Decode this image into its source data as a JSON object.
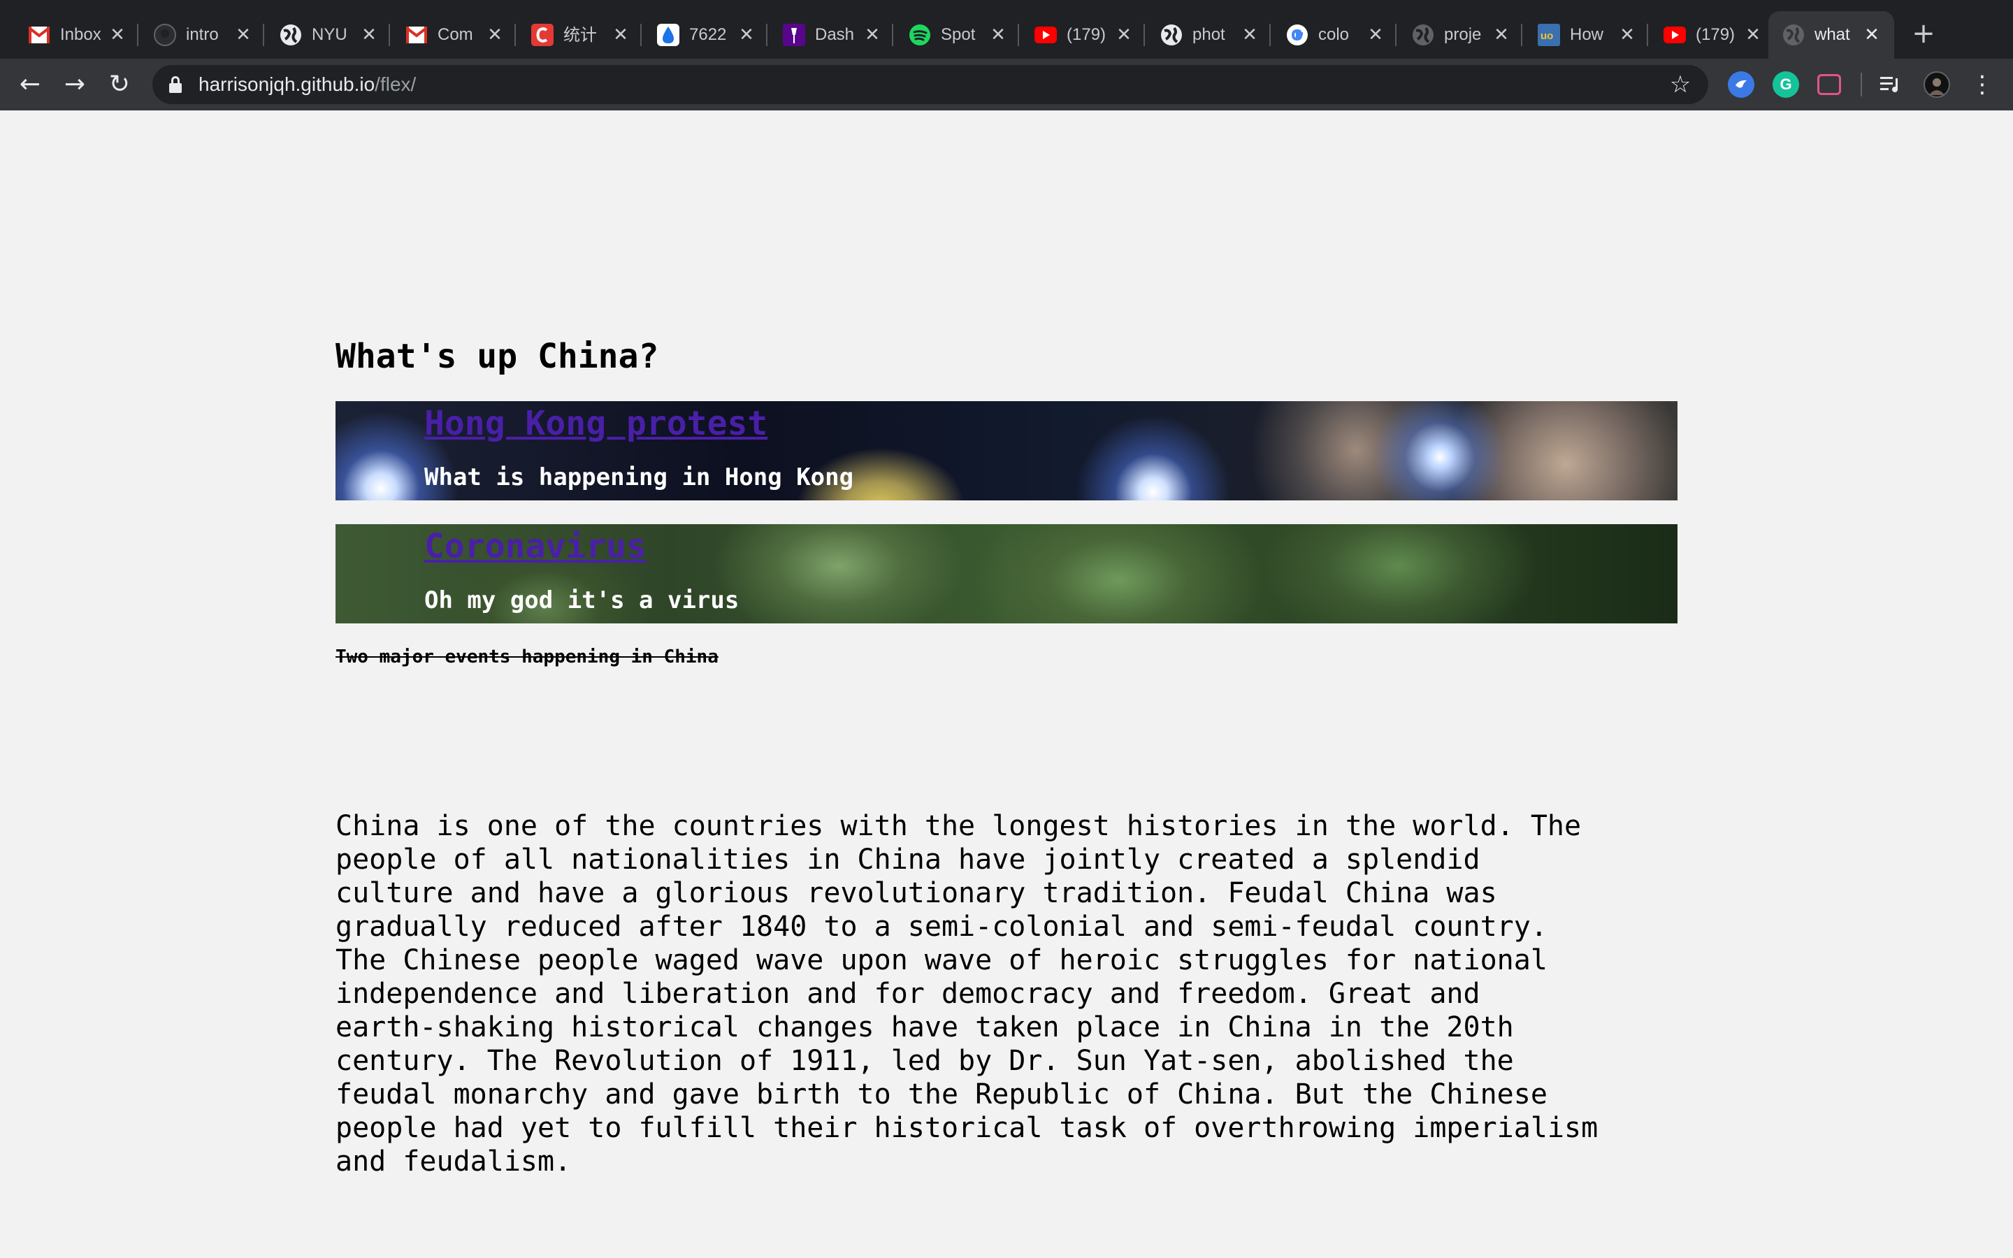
{
  "browser": {
    "tabs": [
      {
        "title": "Inbox",
        "icon": "gmail-icon"
      },
      {
        "title": "intro",
        "icon": "github-icon"
      },
      {
        "title": "NYU",
        "icon": "globe-icon"
      },
      {
        "title": "Com",
        "icon": "gmail-icon"
      },
      {
        "title": "统计",
        "icon": "c-app-icon"
      },
      {
        "title": "7622",
        "icon": "drop-icon"
      },
      {
        "title": "Dash",
        "icon": "nyu-torch-icon"
      },
      {
        "title": "Spot",
        "icon": "spotify-icon"
      },
      {
        "title": "(179)",
        "icon": "youtube-icon"
      },
      {
        "title": "phot",
        "icon": "globe-icon"
      },
      {
        "title": "colo",
        "icon": "google-icon"
      },
      {
        "title": "proje",
        "icon": "globe-icon"
      },
      {
        "title": "How",
        "icon": "uo-icon"
      },
      {
        "title": "(179)",
        "icon": "youtube-icon"
      },
      {
        "title": "what",
        "icon": "globe-icon",
        "active": true
      }
    ],
    "url_host": "harrisonjqh.github.io",
    "url_path": "/flex/",
    "colors": {
      "tabstrip": "#202124",
      "toolbar": "#35363a",
      "omnibox": "#202124"
    }
  },
  "page": {
    "heading": "What's up China?",
    "cards": [
      {
        "title": "Hong Kong protest",
        "subtitle": "What is happening in Hong Kong"
      },
      {
        "title": "Coronavirus",
        "subtitle": "Oh my god it's a virus"
      }
    ],
    "struck_caption": "Two major events happening in China",
    "paragraph_lines": [
      "China is one of the countries with the longest histories in the world. The",
      "people of all nationalities in China have jointly created a splendid",
      "culture and have a glorious revolutionary tradition. Feudal China was",
      "gradually reduced after 1840 to a semi-colonial and semi-feudal country.",
      "The Chinese people waged wave upon wave of heroic struggles for national",
      "independence and liberation and for democracy and freedom. Great and",
      "earth-shaking historical changes have taken place in China in the 20th",
      "century. The Revolution of 1911, led by Dr. Sun Yat-sen, abolished the",
      "feudal monarchy and gave birth to the Republic of China. But the Chinese",
      "people had yet to fulfill their historical task of overthrowing imperialism",
      "and feudalism."
    ],
    "link_color": "#4a1fa8"
  }
}
